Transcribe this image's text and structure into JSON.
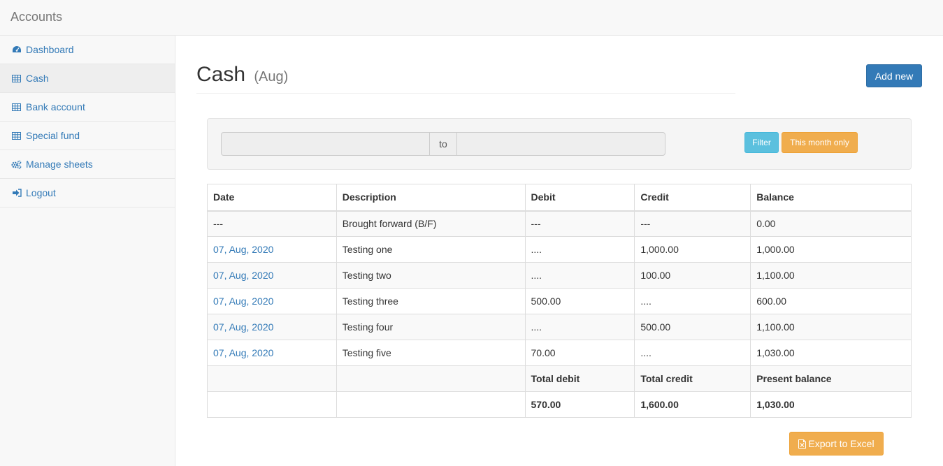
{
  "app": {
    "brand": "Accounts"
  },
  "sidebar": {
    "items": [
      {
        "label": "Dashboard",
        "icon": "dashboard-icon"
      },
      {
        "label": "Cash",
        "icon": "table-icon",
        "active": true
      },
      {
        "label": "Bank account",
        "icon": "table-icon"
      },
      {
        "label": "Special fund",
        "icon": "table-icon"
      },
      {
        "label": "Manage sheets",
        "icon": "cogs-icon"
      },
      {
        "label": "Logout",
        "icon": "logout-icon"
      }
    ]
  },
  "page": {
    "title": "Cash",
    "subtitle": "(Aug)",
    "add_label": "Add new"
  },
  "filter": {
    "from_value": "",
    "to_label": "to",
    "to_value": "",
    "filter_label": "Filter",
    "month_label": "This month only"
  },
  "table": {
    "headers": [
      "Date",
      "Description",
      "Debit",
      "Credit",
      "Balance"
    ],
    "rows": [
      [
        "---",
        "Brought forward (B/F)",
        "---",
        "---",
        "0.00"
      ],
      [
        "07, Aug, 2020",
        "Testing one",
        "....",
        "1,000.00",
        "1,000.00"
      ],
      [
        "07, Aug, 2020",
        "Testing two",
        "....",
        "100.00",
        "1,100.00"
      ],
      [
        "07, Aug, 2020",
        "Testing three",
        "500.00",
        "....",
        "600.00"
      ],
      [
        "07, Aug, 2020",
        "Testing four",
        "....",
        "500.00",
        "1,100.00"
      ],
      [
        "07, Aug, 2020",
        "Testing five",
        "70.00",
        "....",
        "1,030.00"
      ]
    ],
    "totals_labels": [
      "",
      "",
      "Total debit",
      "Total credit",
      "Present balance"
    ],
    "totals_values": [
      "",
      "",
      "570.00",
      "1,600.00",
      "1,030.00"
    ]
  },
  "export": {
    "label": "Export to Excel",
    "icon": "file-excel-icon"
  },
  "colors": {
    "link": "#337ab7",
    "primary": "#337ab7",
    "info": "#5bc0de",
    "warning": "#f0ad4e"
  }
}
